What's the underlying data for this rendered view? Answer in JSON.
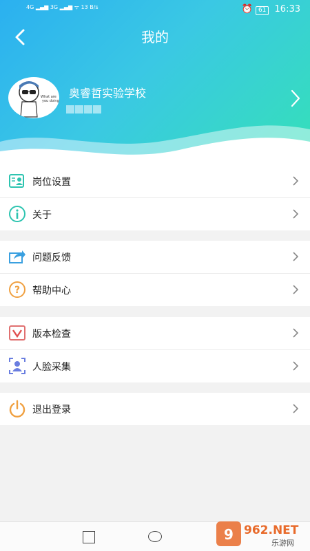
{
  "status_bar": {
    "left": "4G ▂▄▆ 3G ▂▄▆ ᯤ 13 B/s",
    "battery": "61",
    "time": "16:33"
  },
  "header": {
    "title": "我的",
    "school_name": "奥睿哲实验学校"
  },
  "menu_groups": [
    [
      {
        "label": "岗位设置",
        "icon": "id-card-icon"
      },
      {
        "label": "关于",
        "icon": "info-icon"
      }
    ],
    [
      {
        "label": "问题反馈",
        "icon": "share-icon"
      },
      {
        "label": "帮助中心",
        "icon": "question-icon"
      }
    ],
    [
      {
        "label": "版本检查",
        "icon": "version-icon"
      },
      {
        "label": "人脸采集",
        "icon": "face-icon"
      }
    ],
    [
      {
        "label": "退出登录",
        "icon": "power-icon"
      }
    ]
  ],
  "watermark": {
    "brand": "962.NET",
    "sub": "乐游网"
  },
  "colors": {
    "header_start": "#2bb0f0",
    "header_end": "#35e0b8",
    "orange": "#f0a040",
    "teal": "#2dc4b0"
  }
}
